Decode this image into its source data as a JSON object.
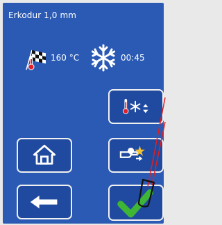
{
  "header": {
    "title": "Erkodur 1,0 mm"
  },
  "status": {
    "temperature": "160 °C",
    "time": "00:45",
    "icons": [
      "checkered-flag-thermometer-icon",
      "snowflake-icon"
    ]
  },
  "buttons": [
    {
      "id": "mode",
      "icon": "thermometer-snowflake-updown-icon"
    },
    {
      "id": "home",
      "icon": "home-icon"
    },
    {
      "id": "chef",
      "icon": "chef-star-icon"
    },
    {
      "id": "back",
      "icon": "left-arrow-icon"
    },
    {
      "id": "ok",
      "icon": "check-icon"
    }
  ],
  "colors": {
    "screen": "#2a5ab4",
    "button_border": "#f0f0f0",
    "check": "#3fb535",
    "thermo": "#e0202a"
  }
}
